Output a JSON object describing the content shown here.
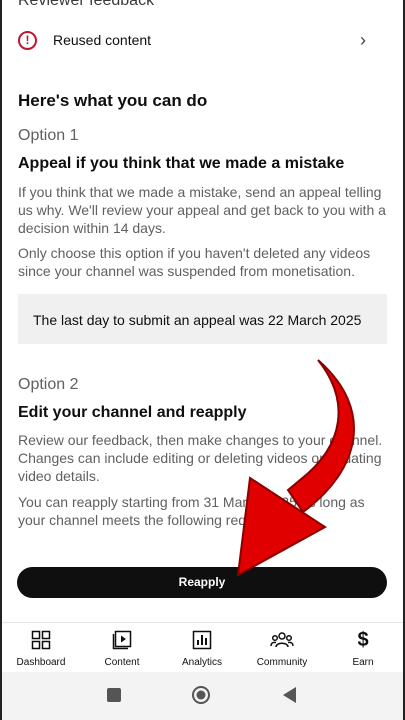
{
  "header": {
    "cut_title": "Reviewer feedback"
  },
  "feedback_item": {
    "label": "Reused content",
    "icon": "warning-icon"
  },
  "section_title": "Here's what you can do",
  "option1": {
    "label": "Option 1",
    "title": "Appeal if you think that we made a mistake",
    "para1": "If you think that we made a mistake, send an appeal telling us why. We'll review your appeal and get back to you with a decision within 14 days.",
    "para2": "Only choose this option if you haven't deleted any videos since your channel was suspended from monetisation.",
    "notice": "The last day to submit an appeal was 22 March 2025"
  },
  "option2": {
    "label": "Option 2",
    "title": "Edit your channel and reapply",
    "para1": "Review our feedback, then make changes to your channel. Changes can include editing or deleting videos or updating video details.",
    "para2": "You can reapply starting from 31 March 2025 as long as your channel meets the following requirements."
  },
  "reapply_button": "Reapply",
  "tabs": [
    {
      "label": "Dashboard",
      "icon": "dashboard-icon"
    },
    {
      "label": "Content",
      "icon": "content-icon"
    },
    {
      "label": "Analytics",
      "icon": "analytics-icon"
    },
    {
      "label": "Community",
      "icon": "community-icon"
    },
    {
      "label": "Earn",
      "icon": "earn-icon"
    }
  ],
  "accent_color": "#c0152f",
  "arrow_color": "#e00000"
}
